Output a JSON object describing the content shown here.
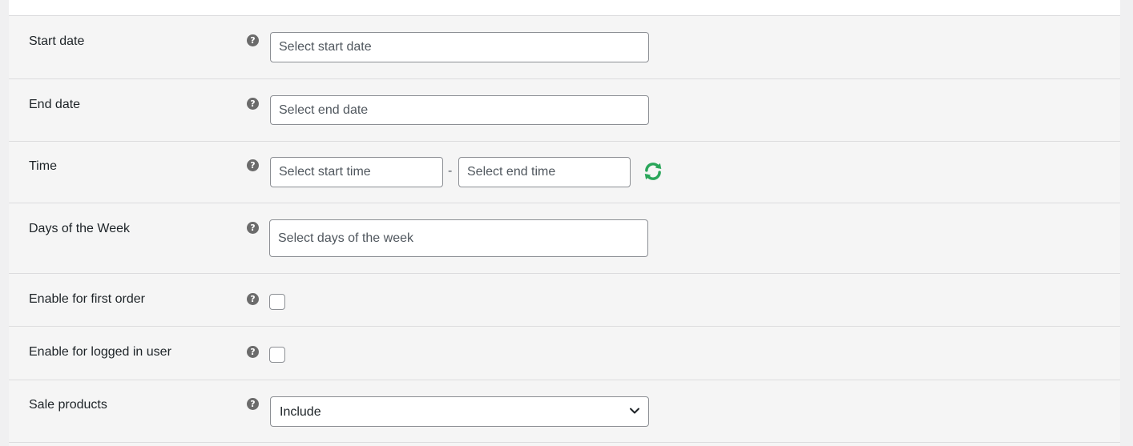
{
  "colors": {
    "panel_bg": "#f5f5f5",
    "reset_icon": "#2aa65a",
    "help_icon": "#6b6b6b"
  },
  "fields": {
    "start_date": {
      "label": "Start date",
      "placeholder": "Select start date"
    },
    "end_date": {
      "label": "End date",
      "placeholder": "Select end date"
    },
    "time": {
      "label": "Time",
      "start_placeholder": "Select start time",
      "separator": "-",
      "end_placeholder": "Select end time"
    },
    "days_of_week": {
      "label": "Days of the Week",
      "placeholder": "Select days of the week"
    },
    "first_order": {
      "label": "Enable for first order",
      "checked": false
    },
    "logged_in_user": {
      "label": "Enable for logged in user",
      "checked": false
    },
    "sale_products": {
      "label": "Sale products",
      "selected": "Include"
    }
  },
  "icons": {
    "help": "question-circle-icon",
    "reset": "refresh-icon",
    "dropdown": "chevron-down-icon"
  }
}
